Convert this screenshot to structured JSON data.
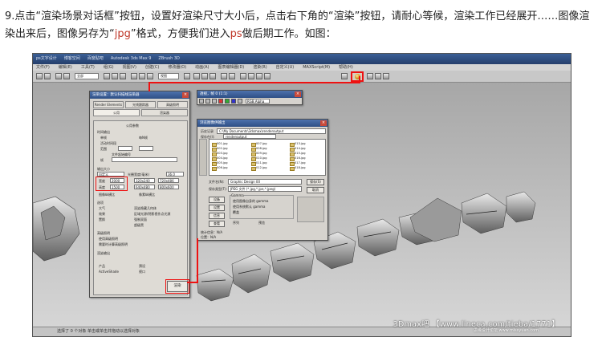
{
  "instruction": {
    "part1": "9.点击“渲染场景对话框”按钮，设置好渲染尺寸大小后，点击右下角的“渲染”按钮，请耐心等候，渲染工作已经展开……图像渲染出来后，图像另存为“",
    "jpg": "jpg",
    "part2": "”格式，方便我们进入",
    "ps": "ps",
    "part3": "做后期工作。如图："
  },
  "app": {
    "title": "ps文字设计 - 3ds Max 2011",
    "tabs": [
      "ps文字设计",
      "博客空间",
      "百度贴吧",
      "Autodesk 3ds Max 9",
      "ZBrush 3D"
    ],
    "menu": [
      "文件(F)",
      "编辑(E)",
      "工具(T)",
      "组(G)",
      "视图(V)",
      "创建(C)",
      "修改器(O)",
      "动画(A)",
      "图表编辑器(D)",
      "渲染(R)",
      "自定义(U)",
      "MAXScript(M)",
      "帮助(H)"
    ],
    "view_select": "全部",
    "coord_select": "视图",
    "status": "选择了 0 个对象   单击或单击并拖动以选择对象",
    "watermark": "3Dmax吧 【www.lineca.com/tieba/1771】",
    "watermark_small": "思缘设计论坛 www.missyuan.com"
  },
  "render_setup": {
    "title": "渲染设置：默认扫描线渲染器",
    "tabs": [
      "Render Elements",
      "光线跟踪器",
      "高级照明",
      "公用",
      "渲染器"
    ],
    "section": "公用参数",
    "time_output": "时间输出",
    "single": "单帧",
    "every_n": "每N帧",
    "active_segment": "活动时间段",
    "range": "范围",
    "file_number_base": "文件起始编号",
    "frames": "帧",
    "output_size": "输出大小",
    "output_size_preset": "自定义",
    "aperture": "光圈宽度(毫米)",
    "aperture_value": "36.0",
    "width_label": "宽度",
    "width_value": "2000",
    "height_label": "高度",
    "height_value": "1500",
    "presets": [
      "320x240",
      "720x486",
      "640x480",
      "800x600"
    ],
    "image_aspect": "图像纵横比",
    "pixel_aspect": "像素纵横比",
    "options": "选项",
    "atmospherics": "大气",
    "effects": "效果",
    "displacement": "置换",
    "render_hidden": "渲染隐藏几何体",
    "area_lights": "区域光源/阴影视作点光源",
    "force_2sided": "强制双面",
    "super_black": "超级黑",
    "advanced_lighting": "高级照明",
    "use_advanced": "使用高级照明",
    "compute_when_required": "需要时计算高级照明",
    "render_output": "渲染输出",
    "mode_product": "产品",
    "mode_activeshade": "ActiveShade",
    "preset": "预设",
    "view": "视口",
    "render_button": "渲染"
  },
  "frame_window": {
    "title": "透视，帧 0 (1:1)",
    "channel": "RGB Alpha"
  },
  "save_dialog": {
    "title": "浏览图像供输出",
    "history_label": "历史记录",
    "history_value": "C:\\My Documents\\3dsmax\\renderoutput",
    "save_in_label": "保存在(I):",
    "save_in_value": "renderoutput",
    "files": [
      "001.jpg",
      "002.jpg",
      "003.jpg",
      "004.jpg",
      "005.jpg",
      "006.jpg",
      "007.jpg",
      "008.jpg",
      "009.jpg",
      "010.jpg",
      "011.jpg",
      "012.jpg",
      "013.jpg",
      "014.jpg",
      "015.jpg",
      "016.jpg",
      "017.jpg",
      "018.jpg"
    ],
    "filename_label": "文件名(N):",
    "filename_value": "Graphic Design 00",
    "type_label": "保存类型(T):",
    "type_value": "JPEG 文件 (*.jpg,*.jpe,*.jpeg)",
    "save_btn": "保存(S)",
    "cancel_btn": "取消",
    "devices": "设备",
    "setup": "设置",
    "info": "信息",
    "view": "查看",
    "gamma": "Gamma",
    "use_image_gamma": "使用图像自身的 gamma",
    "use_system_gamma": "使用系统默认 gamma",
    "override": "覆盖",
    "sequence": "序列",
    "preview": "预览",
    "stats": "统计信息：N/A",
    "location": "位置：N/A"
  }
}
